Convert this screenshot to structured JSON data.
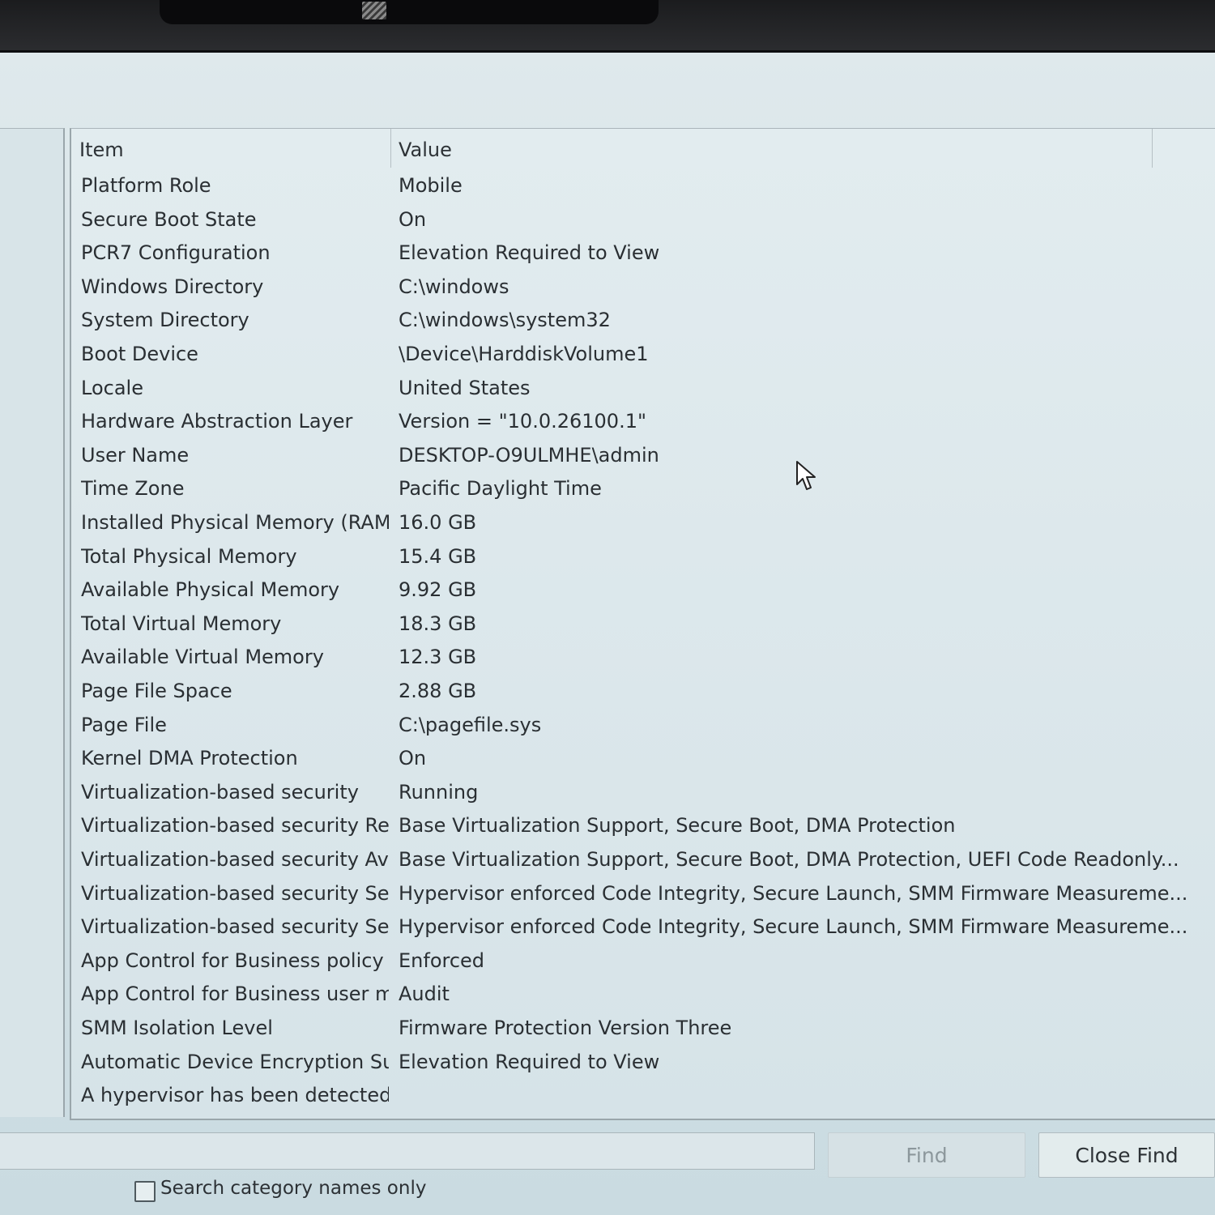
{
  "list": {
    "columns": {
      "item": "Item",
      "value": "Value"
    },
    "rows": [
      {
        "item": "Platform Role",
        "value": "Mobile"
      },
      {
        "item": "Secure Boot State",
        "value": "On"
      },
      {
        "item": "PCR7 Configuration",
        "value": "Elevation Required to View"
      },
      {
        "item": "Windows Directory",
        "value": "C:\\windows"
      },
      {
        "item": "System Directory",
        "value": "C:\\windows\\system32"
      },
      {
        "item": "Boot Device",
        "value": "\\Device\\HarddiskVolume1"
      },
      {
        "item": "Locale",
        "value": "United States"
      },
      {
        "item": "Hardware Abstraction Layer",
        "value": "Version = \"10.0.26100.1\""
      },
      {
        "item": "User Name",
        "value": "DESKTOP-O9ULMHE\\admin"
      },
      {
        "item": "Time Zone",
        "value": "Pacific Daylight Time"
      },
      {
        "item": "Installed Physical Memory (RAM)",
        "value": "16.0 GB"
      },
      {
        "item": "Total Physical Memory",
        "value": "15.4 GB"
      },
      {
        "item": "Available Physical Memory",
        "value": "9.92 GB"
      },
      {
        "item": "Total Virtual Memory",
        "value": "18.3 GB"
      },
      {
        "item": "Available Virtual Memory",
        "value": "12.3 GB"
      },
      {
        "item": "Page File Space",
        "value": "2.88 GB"
      },
      {
        "item": "Page File",
        "value": "C:\\pagefile.sys"
      },
      {
        "item": "Kernel DMA Protection",
        "value": "On"
      },
      {
        "item": "Virtualization-based security",
        "value": "Running"
      },
      {
        "item": "Virtualization-based security Re...",
        "value": "Base Virtualization Support, Secure Boot, DMA Protection"
      },
      {
        "item": "Virtualization-based security Av...",
        "value": "Base Virtualization Support, Secure Boot, DMA Protection, UEFI Code Readonly..."
      },
      {
        "item": "Virtualization-based security Se...",
        "value": "Hypervisor enforced Code Integrity, Secure Launch, SMM Firmware Measureme..."
      },
      {
        "item": "Virtualization-based security Se...",
        "value": "Hypervisor enforced Code Integrity, Secure Launch, SMM Firmware Measureme..."
      },
      {
        "item": "App Control for Business policy",
        "value": "Enforced"
      },
      {
        "item": "App Control for Business user m...",
        "value": "Audit"
      },
      {
        "item": "SMM Isolation Level",
        "value": "Firmware Protection Version Three"
      },
      {
        "item": "Automatic Device Encryption Su...",
        "value": "Elevation Required to View"
      },
      {
        "item": "A hypervisor has been detected....",
        "value": ""
      }
    ]
  },
  "find_bar": {
    "search_value": "",
    "find_label": "Find",
    "close_find_label": "Close Find",
    "checkbox_label": "Search category names only",
    "checkbox_checked": false
  },
  "icons": {
    "cursor": "mouse-pointer-icon",
    "shutter": "camera-shutter-icon"
  }
}
